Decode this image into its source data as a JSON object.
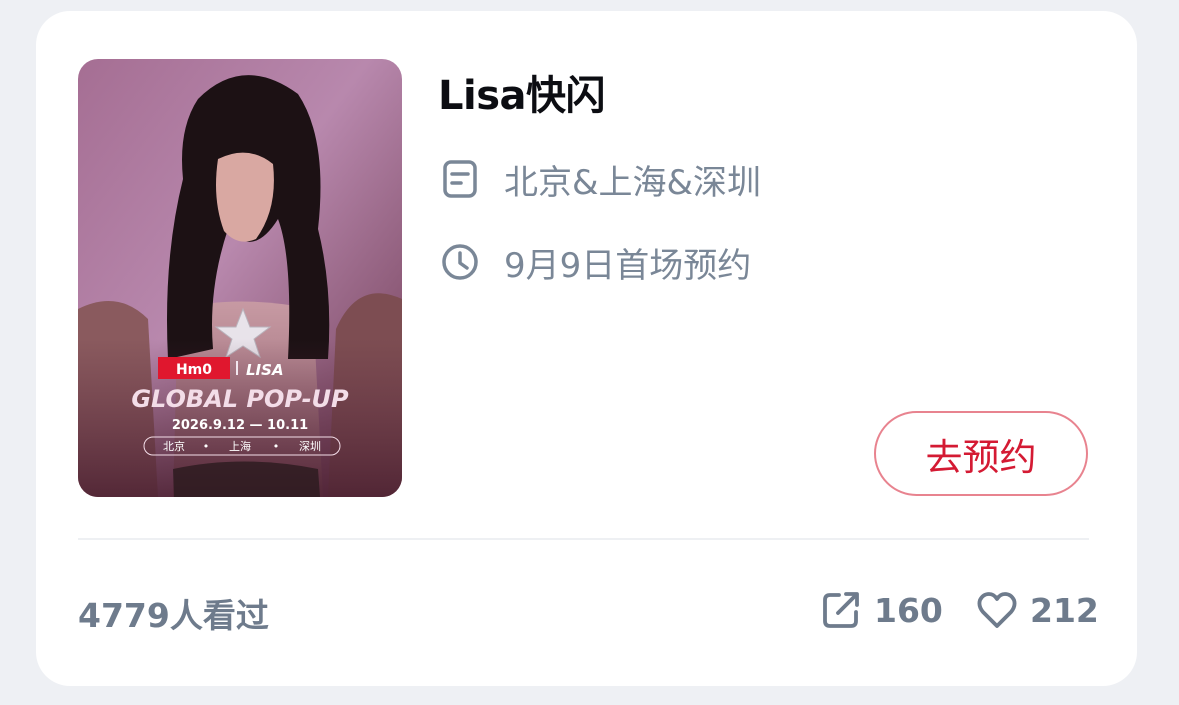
{
  "event": {
    "title": "Lisa快闪",
    "location": "北京&上海&深圳",
    "time": "9月9日首场预约",
    "reserve_label": "去预约"
  },
  "poster": {
    "brand_left": "Hm0",
    "brand_right": "LISA",
    "headline": "GLOBAL POP-UP",
    "dates": "2026.9.12 — 10.11",
    "cities": [
      "北京",
      "上海",
      "深圳"
    ]
  },
  "stats": {
    "views": "4779人看过",
    "shares": "160",
    "likes": "212"
  },
  "icons": {
    "location": "document-list-icon",
    "time": "clock-icon",
    "share": "share-arrow-icon",
    "like": "heart-icon"
  },
  "colors": {
    "accent": "#d41a33",
    "button_border": "#e8838f",
    "muted_text": "#7a8797"
  }
}
